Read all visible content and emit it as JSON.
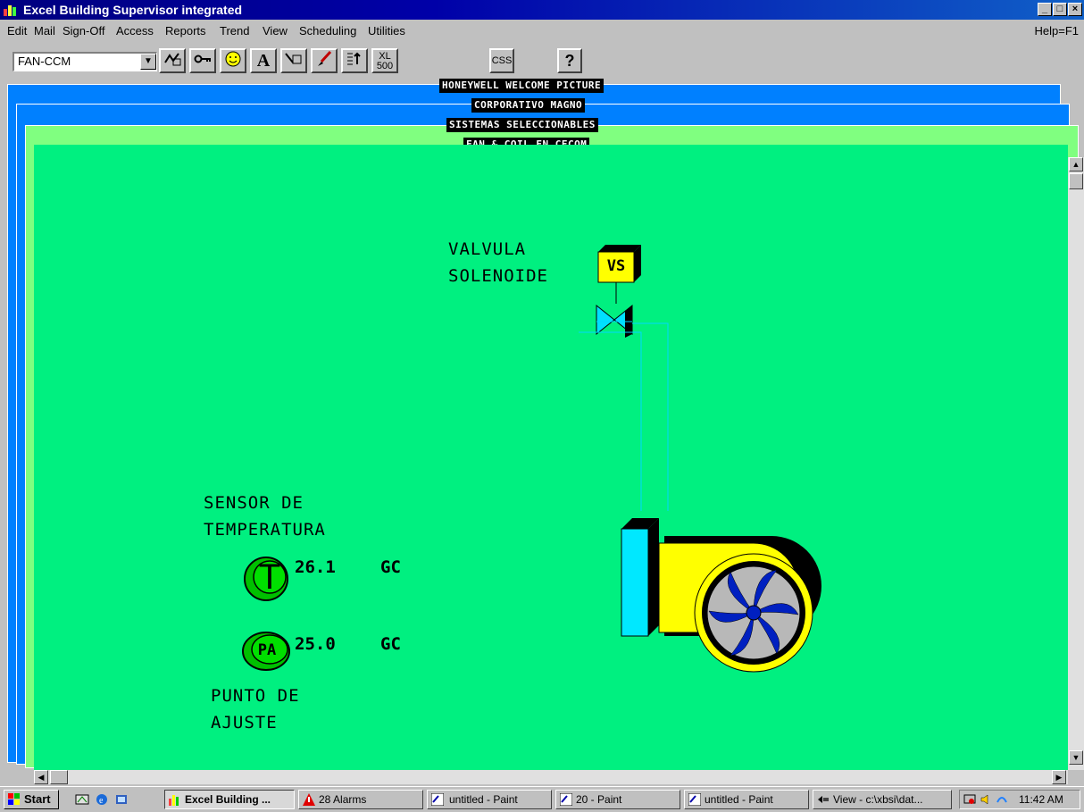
{
  "window": {
    "title": "Excel Building Supervisor integrated",
    "help_hint": "Help=F1"
  },
  "menu": [
    "Edit",
    "Mail",
    "Sign-Off",
    "Access",
    "Reports",
    "Trend",
    "View",
    "Scheduling",
    "Utilities"
  ],
  "toolbar": {
    "point_selector": "FAN-CCM",
    "css_label": "CSS",
    "help_label": "?",
    "text_a_label": "A",
    "xl500_label": "XL 500"
  },
  "layers": [
    {
      "title": "HONEYWELL WELCOME PICTURE",
      "color": "#0080ff"
    },
    {
      "title": "CORPORATIVO MAGNO",
      "color": "#0080ff"
    },
    {
      "title": "SISTEMAS SELECCIONABLES",
      "color": "#80ff80"
    },
    {
      "title": "FAN & COIL EN CECOM",
      "color": "#00f080"
    }
  ],
  "graphic": {
    "valve_label_1": "VALVULA",
    "valve_label_2": "SOLENOIDE",
    "valve_code": "VS",
    "sensor_label_1": "SENSOR DE",
    "sensor_label_2": "TEMPERATURA",
    "temp_symbol": "T",
    "temp_value": "26.1",
    "temp_unit": "GC",
    "setpoint_symbol": "PA",
    "setpoint_value": "25.0",
    "setpoint_unit": "GC",
    "setpoint_label_1": "PUNTO DE",
    "setpoint_label_2": "AJUSTE"
  },
  "taskbar": {
    "start": "Start",
    "tasks": [
      "Excel Building ...",
      "28 Alarms",
      "untitled - Paint",
      "20 - Paint",
      "untitled - Paint",
      "View - c:\\xbsi\\dat..."
    ],
    "clock": "11:42 AM"
  }
}
